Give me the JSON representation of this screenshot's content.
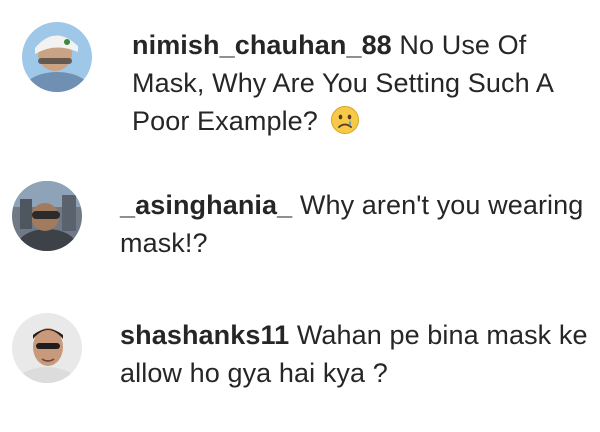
{
  "comments": [
    {
      "username": "nimish_chauhan_88",
      "text": "No Use Of Mask, Why Are You Setting Such A Poor Example?",
      "emoji": "crying-face"
    },
    {
      "username": "_asinghania_",
      "text": "Why aren't you wearing mask!?"
    },
    {
      "username": "shashanks11",
      "text": "Wahan pe bina mask ke allow ho gya hai kya ?"
    }
  ]
}
